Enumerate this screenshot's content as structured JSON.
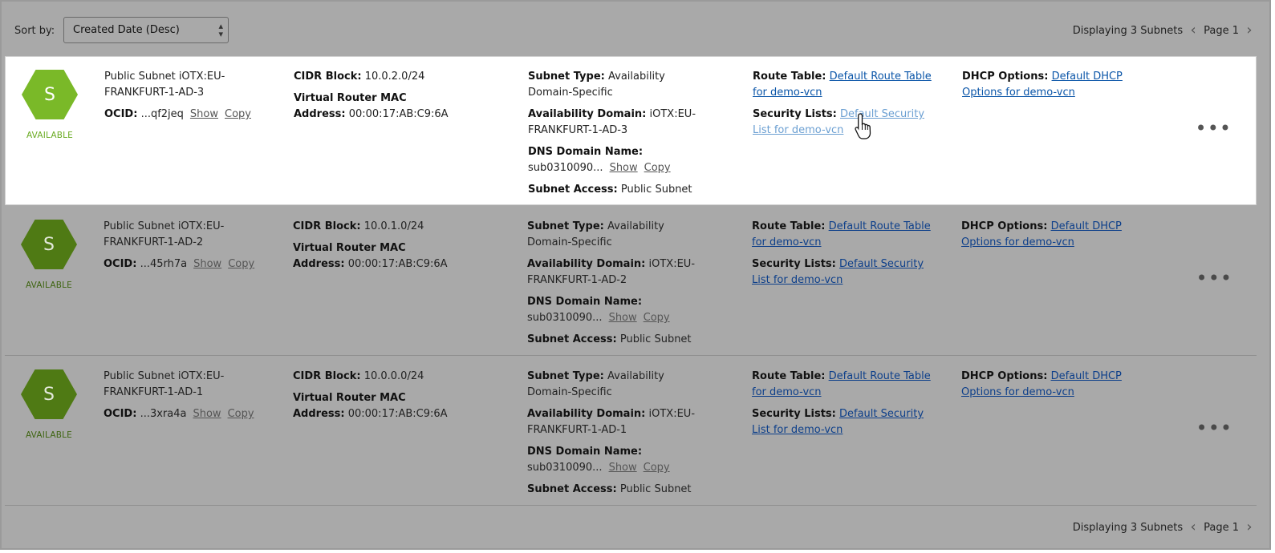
{
  "toolbar": {
    "sort_label": "Sort by:",
    "sort_value": "Created Date (Desc)",
    "sort_icon": "up-down-arrows-icon"
  },
  "pager": {
    "display_text": "Displaying 3 Subnets",
    "page_text": "Page 1",
    "prev_icon": "chevron-left-icon",
    "next_icon": "chevron-right-icon"
  },
  "subnets": [
    {
      "initial": "S",
      "status": "AVAILABLE",
      "name": "Public Subnet iOTX:EU-FRANKFURT-1-AD-3",
      "ocid_label": "OCID:",
      "ocid_value": "...qf2jeq",
      "show": "Show",
      "copy": "Copy",
      "cidr_label": "CIDR Block:",
      "cidr_value": "10.0.2.0/24",
      "vr_label": "Virtual Router MAC Address:",
      "vr_value": "00:00:17:AB:C9:6A",
      "subnet_type_label": "Subnet Type:",
      "subnet_type_value": "Availability Domain-Specific",
      "ad_label": "Availability Domain:",
      "ad_value": "iOTX:EU-FRANKFURT-1-AD-3",
      "dns_label": "DNS Domain Name:",
      "dns_value": "sub0310090...",
      "access_label": "Subnet Access:",
      "access_value": "Public Subnet",
      "route_label": "Route Table:",
      "route_value": "Default Route Table for demo-vcn",
      "seclist_label": "Security Lists:",
      "seclist_value": "Default Security List for demo-vcn",
      "dhcp_label": "DHCP Options:",
      "dhcp_value": "Default DHCP Options for demo-vcn",
      "actions_icon": "more-options-icon"
    },
    {
      "initial": "S",
      "status": "AVAILABLE",
      "name": "Public Subnet iOTX:EU-FRANKFURT-1-AD-2",
      "ocid_label": "OCID:",
      "ocid_value": "...45rh7a",
      "show": "Show",
      "copy": "Copy",
      "cidr_label": "CIDR Block:",
      "cidr_value": "10.0.1.0/24",
      "vr_label": "Virtual Router MAC Address:",
      "vr_value": "00:00:17:AB:C9:6A",
      "subnet_type_label": "Subnet Type:",
      "subnet_type_value": "Availability Domain-Specific",
      "ad_label": "Availability Domain:",
      "ad_value": "iOTX:EU-FRANKFURT-1-AD-2",
      "dns_label": "DNS Domain Name:",
      "dns_value": "sub0310090...",
      "access_label": "Subnet Access:",
      "access_value": "Public Subnet",
      "route_label": "Route Table:",
      "route_value": "Default Route Table for demo-vcn",
      "seclist_label": "Security Lists:",
      "seclist_value": "Default Security List for demo-vcn",
      "dhcp_label": "DHCP Options:",
      "dhcp_value": "Default DHCP Options for demo-vcn",
      "actions_icon": "more-options-icon"
    },
    {
      "initial": "S",
      "status": "AVAILABLE",
      "name": "Public Subnet iOTX:EU-FRANKFURT-1-AD-1",
      "ocid_label": "OCID:",
      "ocid_value": "...3xra4a",
      "show": "Show",
      "copy": "Copy",
      "cidr_label": "CIDR Block:",
      "cidr_value": "10.0.0.0/24",
      "vr_label": "Virtual Router MAC Address:",
      "vr_value": "00:00:17:AB:C9:6A",
      "subnet_type_label": "Subnet Type:",
      "subnet_type_value": "Availability Domain-Specific",
      "ad_label": "Availability Domain:",
      "ad_value": "iOTX:EU-FRANKFURT-1-AD-1",
      "dns_label": "DNS Domain Name:",
      "dns_value": "sub0310090...",
      "access_label": "Subnet Access:",
      "access_value": "Public Subnet",
      "route_label": "Route Table:",
      "route_value": "Default Route Table for demo-vcn",
      "seclist_label": "Security Lists:",
      "seclist_value": "Default Security List for demo-vcn",
      "dhcp_label": "DHCP Options:",
      "dhcp_value": "Default DHCP Options for demo-vcn",
      "actions_icon": "more-options-icon"
    }
  ]
}
